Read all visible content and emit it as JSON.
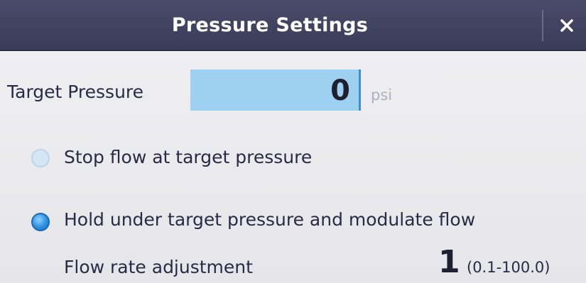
{
  "dialog": {
    "title": "Pressure Settings",
    "close_label": "×"
  },
  "target_pressure": {
    "label": "Target Pressure",
    "value": "0",
    "unit": "psi"
  },
  "options": {
    "stop_flow": {
      "label": "Stop flow at target pressure",
      "selected": false
    },
    "hold_modulate": {
      "label": "Hold under target pressure and modulate flow",
      "selected": true
    }
  },
  "flow_rate": {
    "label": "Flow rate adjustment",
    "value": "1",
    "range": "(0.1-100.0)"
  },
  "colors": {
    "titlebar": "#3f405e",
    "input_highlight": "#9ed0f2",
    "radio_selected": "#2c8fe0"
  }
}
